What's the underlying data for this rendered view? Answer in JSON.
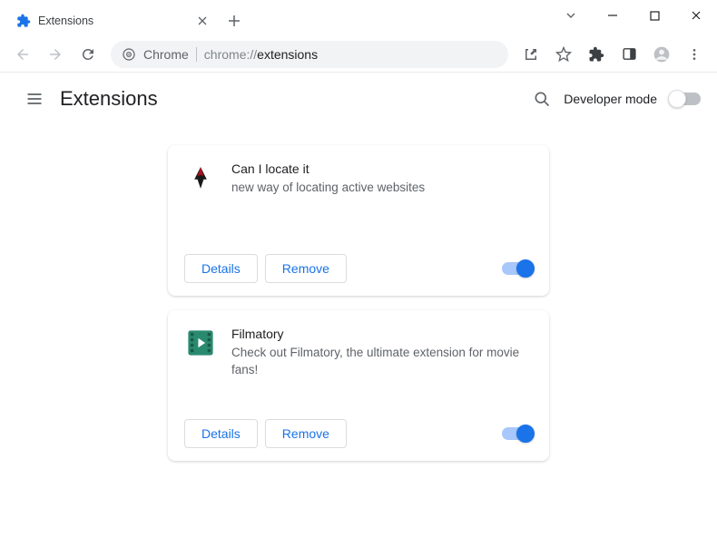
{
  "window": {
    "tab_title": "Extensions"
  },
  "omnibox": {
    "host_label": "Chrome",
    "url_scheme": "chrome://",
    "url_path": "extensions"
  },
  "header": {
    "title": "Extensions",
    "dev_mode_label": "Developer mode",
    "dev_mode_on": false
  },
  "buttons": {
    "details": "Details",
    "remove": "Remove"
  },
  "extensions": [
    {
      "name": "Can I locate it",
      "description": "new way of locating active websites",
      "enabled": true,
      "icon": "bird"
    },
    {
      "name": "Filmatory",
      "description": "Check out Filmatory, the ultimate extension for movie fans!",
      "enabled": true,
      "icon": "film"
    }
  ]
}
